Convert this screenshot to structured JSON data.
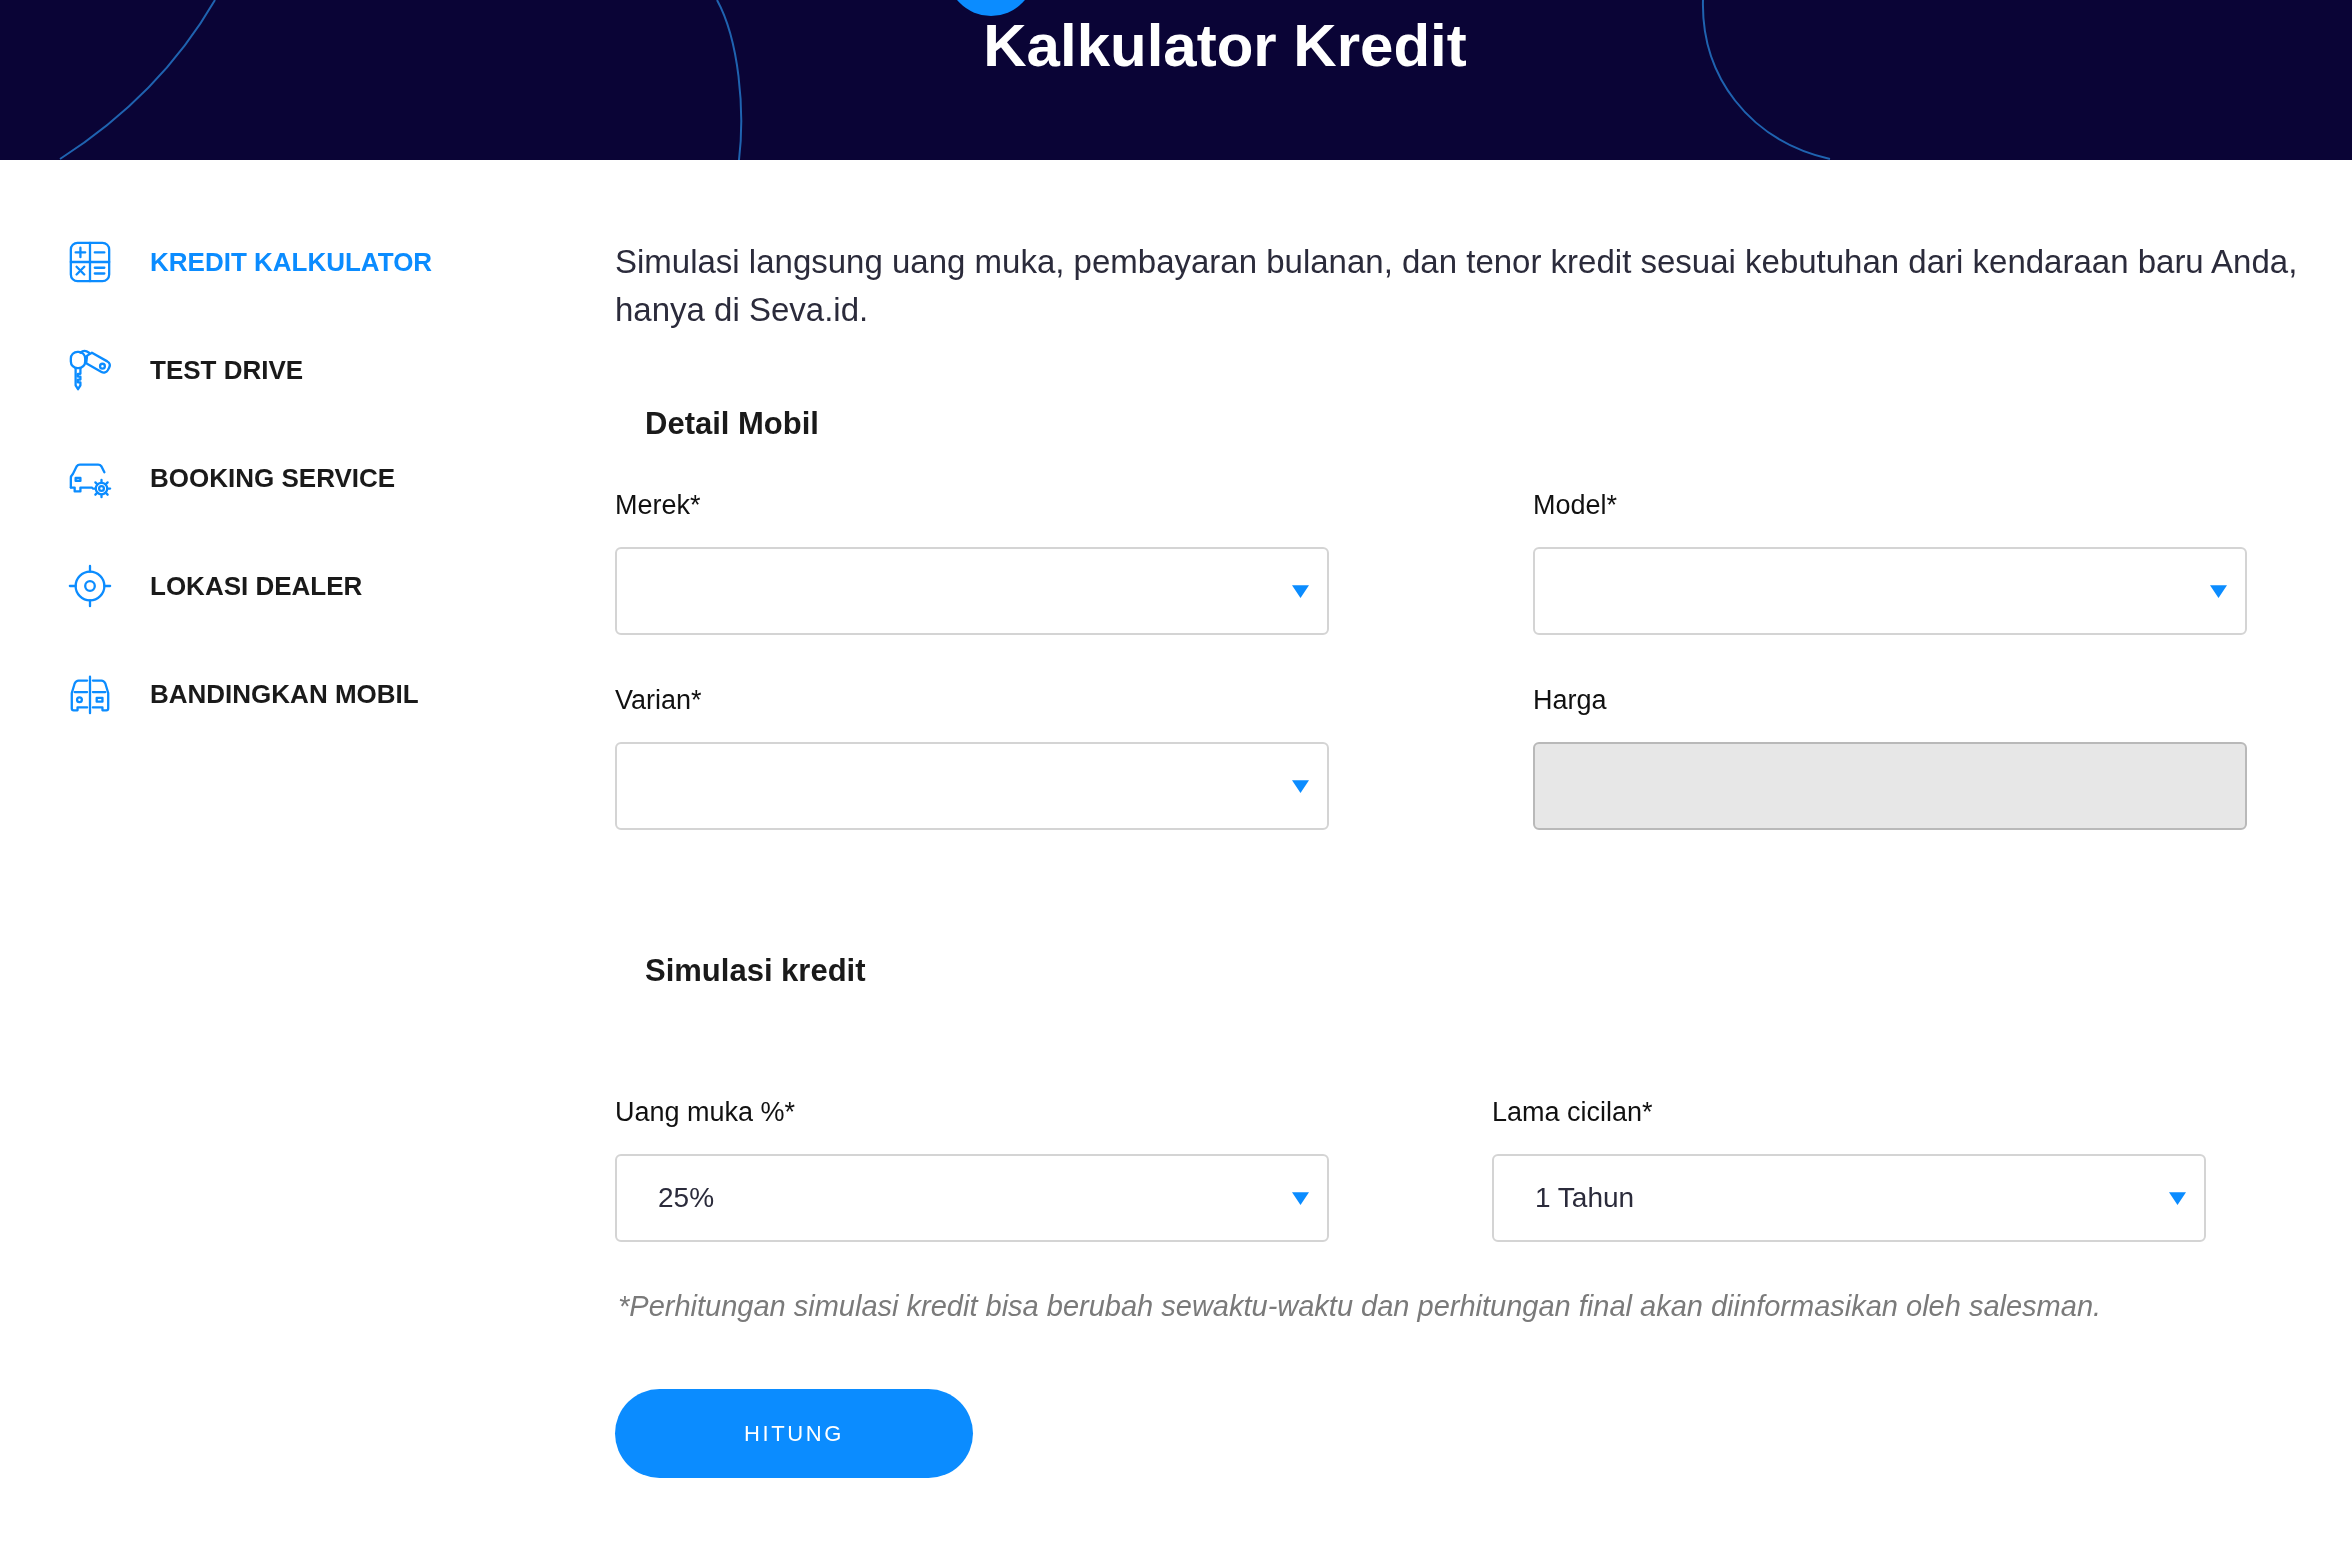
{
  "header": {
    "title": "Kalkulator Kredit"
  },
  "sidebar": {
    "items": [
      {
        "label": "KREDIT KALKULATOR",
        "selected": true
      },
      {
        "label": "TEST DRIVE",
        "selected": false
      },
      {
        "label": "BOOKING SERVICE",
        "selected": false
      },
      {
        "label": "LOKASI DEALER",
        "selected": false
      },
      {
        "label": "BANDINGKAN MOBIL",
        "selected": false
      }
    ]
  },
  "intro": "Simulasi langsung uang muka, pembayaran bulanan, dan tenor kredit sesuai kebutuhan dari kendaraan baru Anda, hanya di Seva.id.",
  "sections": [
    {
      "title": "Detail Mobil",
      "fields": [
        {
          "label": "Merek*",
          "kind": "select",
          "disabled": false
        },
        {
          "label": "Model*",
          "kind": "select",
          "disabled": false
        },
        {
          "label": "Varian*",
          "kind": "select",
          "disabled": false
        },
        {
          "label": "Harga",
          "kind": "text",
          "disabled": true
        }
      ]
    },
    {
      "title": "Simulasi kredit",
      "fields": [
        {
          "label": "Uang muka %*",
          "kind": "select",
          "disabled": false,
          "value": "25%"
        },
        {
          "label": "Lama cicilan*",
          "kind": "select",
          "disabled": false,
          "value": "1 Tahun"
        }
      ]
    }
  ],
  "note": "*Perhitungan simulasi kredit bisa berubah sewaktu-waktu dan perhitungan final akan diinformasikan oleh salesman.",
  "submit_button": {
    "label": "HITUNG"
  }
}
